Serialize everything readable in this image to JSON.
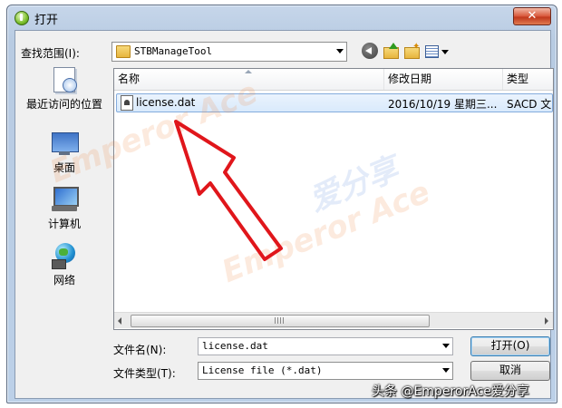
{
  "window": {
    "title": "打开",
    "close_symbol": "✕"
  },
  "toolbar": {
    "look_in_label": "查找范围(I):",
    "look_in_value": "STBManageTool"
  },
  "places": [
    {
      "label": "最近访问的位置",
      "icon": "recent-places-icon"
    },
    {
      "label": "桌面",
      "icon": "desktop-icon"
    },
    {
      "label": "计算机",
      "icon": "computer-icon"
    },
    {
      "label": "网络",
      "icon": "network-icon"
    }
  ],
  "file_list": {
    "columns": [
      "名称",
      "修改日期",
      "类型"
    ],
    "rows": [
      {
        "name": "license.dat",
        "date": "2016/10/19 星期三...",
        "type": "SACD 文"
      }
    ],
    "scrollbar_grip": "|||"
  },
  "footer": {
    "file_name_label": "文件名(N):",
    "file_name_value": "license.dat",
    "file_type_label": "文件类型(T):",
    "file_type_value": "License file (*.dat)",
    "open_button": "打开(O)",
    "cancel_button": "取消"
  },
  "overlay": {
    "caption": "头条 @EmperorAce爱分享",
    "watermark_text": "Emperor Ace",
    "watermark_text_2": "爱分享",
    "arrow_color": "#e0161b"
  }
}
